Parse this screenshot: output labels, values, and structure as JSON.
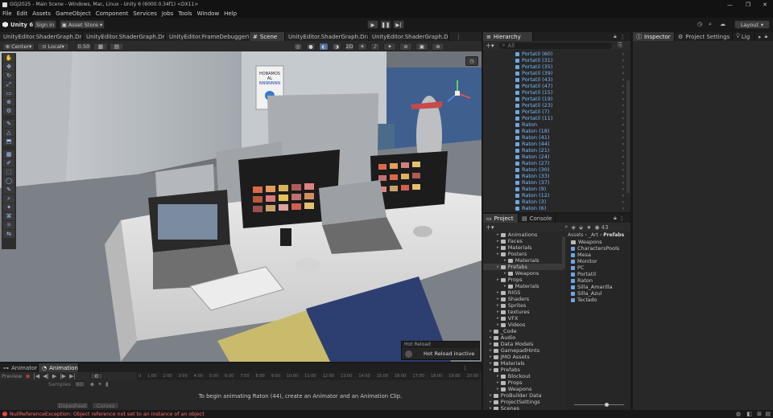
{
  "window": {
    "title": "GGJ2025 - Main Scene - Windows, Mac, Linux - Unity 6 (6000.0.34f1) <DX11>"
  },
  "menu": [
    "File",
    "Edit",
    "Assets",
    "GameObject",
    "Component",
    "Services",
    "Jobs",
    "Tools",
    "Window",
    "Help"
  ],
  "toolbar": {
    "unity_label": "Unity 6",
    "sign_in": "Sign in",
    "asset_store": "Asset Store",
    "layout": "Layout"
  },
  "scene_tabs": [
    "UnityEditor.ShaderGraph.Drawin",
    "UnityEditor.ShaderGraph.Drawin",
    "UnityEditor.FrameDebuggerWind",
    "Scene",
    "UnityEditor.ShaderGraph.Drawin",
    "UnityEditor.ShaderGraph.Drawin"
  ],
  "scene_toolbar": {
    "pivot": "Center",
    "space": "Local",
    "snap": "0.50"
  },
  "hierarchy": {
    "tab": "Hierarchy",
    "search_placeholder": "All",
    "items": [
      "Portatil (60)",
      "Portatil (31)",
      "Portatil (35)",
      "Portatil (39)",
      "Portatil (43)",
      "Portatil (47)",
      "Portatil (15)",
      "Portatil (19)",
      "Portatil (23)",
      "Portatil (7)",
      "Portatil (11)",
      "Raton",
      "Raton (18)",
      "Raton (41)",
      "Raton (44)",
      "Raton (21)",
      "Raton (24)",
      "Raton (27)",
      "Raton (30)",
      "Raton (33)",
      "Raton (37)",
      "Raton (9)",
      "Raton (12)",
      "Raton (3)",
      "Raton (6)"
    ]
  },
  "project": {
    "tabs": [
      "Project",
      "Console"
    ],
    "count": "43",
    "breadcrumb": [
      "Assets",
      "_Art",
      "Prefabs"
    ],
    "tree": [
      {
        "label": "Animations",
        "indent": 1
      },
      {
        "label": "Faces",
        "indent": 1
      },
      {
        "label": "Materials",
        "indent": 1
      },
      {
        "label": "Posters",
        "indent": 1
      },
      {
        "label": "Materials",
        "indent": 2
      },
      {
        "label": "Prefabs",
        "indent": 1
      },
      {
        "label": "Weapons",
        "indent": 2
      },
      {
        "label": "Props",
        "indent": 1
      },
      {
        "label": "Materials",
        "indent": 2
      },
      {
        "label": "RIGS",
        "indent": 1
      },
      {
        "label": "Shaders",
        "indent": 1
      },
      {
        "label": "Sprites",
        "indent": 1
      },
      {
        "label": "textures",
        "indent": 1
      },
      {
        "label": "VFX",
        "indent": 1
      },
      {
        "label": "Videos",
        "indent": 1
      },
      {
        "label": "_Code",
        "indent": 0
      },
      {
        "label": "Audio",
        "indent": 0
      },
      {
        "label": "Data Models",
        "indent": 0
      },
      {
        "label": "GamepadHints",
        "indent": 0
      },
      {
        "label": "JMO Assets",
        "indent": 0
      },
      {
        "label": "Materials",
        "indent": 0
      },
      {
        "label": "Prefabs",
        "indent": 0
      },
      {
        "label": "Blockout",
        "indent": 1
      },
      {
        "label": "Props",
        "indent": 1
      },
      {
        "label": "Weapons",
        "indent": 1
      },
      {
        "label": "ProBuilder Data",
        "indent": 0
      },
      {
        "label": "ProjectSettings",
        "indent": 0
      },
      {
        "label": "Scenes",
        "indent": 0
      }
    ],
    "assets": [
      "Weapons",
      "CharactersPools",
      "Mesa",
      "Monitor",
      "PC",
      "Portatil",
      "Raton",
      "Silla_Amarilla",
      "Silla_Azul",
      "Teclado"
    ]
  },
  "inspector": {
    "tabs": [
      "Inspector",
      "Project Settings",
      "Lig"
    ]
  },
  "animation": {
    "tabs": [
      "Animator",
      "Animation"
    ],
    "preview": "Preview",
    "samples_label": "Samples",
    "samples_value": "60",
    "message": "To begin animating Raton (44), create an Animator and an Animation Clip.",
    "dopesheet": "Dopesheet",
    "curves": "Curves",
    "ruler": [
      "0",
      "1:00",
      "2:00",
      "3:00",
      "4:00",
      "5:00",
      "6:00",
      "7:00",
      "8:00",
      "9:00",
      "10:00",
      "11:00",
      "12:00",
      "13:00",
      "14:00",
      "15:00",
      "16:00",
      "17:00",
      "18:00",
      "19:00",
      "20:00"
    ]
  },
  "hot_reload": {
    "title": "Hot Reload",
    "status": "Hot Reload inactive"
  },
  "poster": {
    "lines": [
      "HOBAMOS",
      "AL",
      "NNNNNNN"
    ]
  },
  "status": {
    "error": "NullReferenceException: Object reference not set to an instance of an object"
  },
  "colors": {
    "accent": "#3d7bd9",
    "error": "#ff6b6b",
    "link": "#7ab9ff"
  }
}
